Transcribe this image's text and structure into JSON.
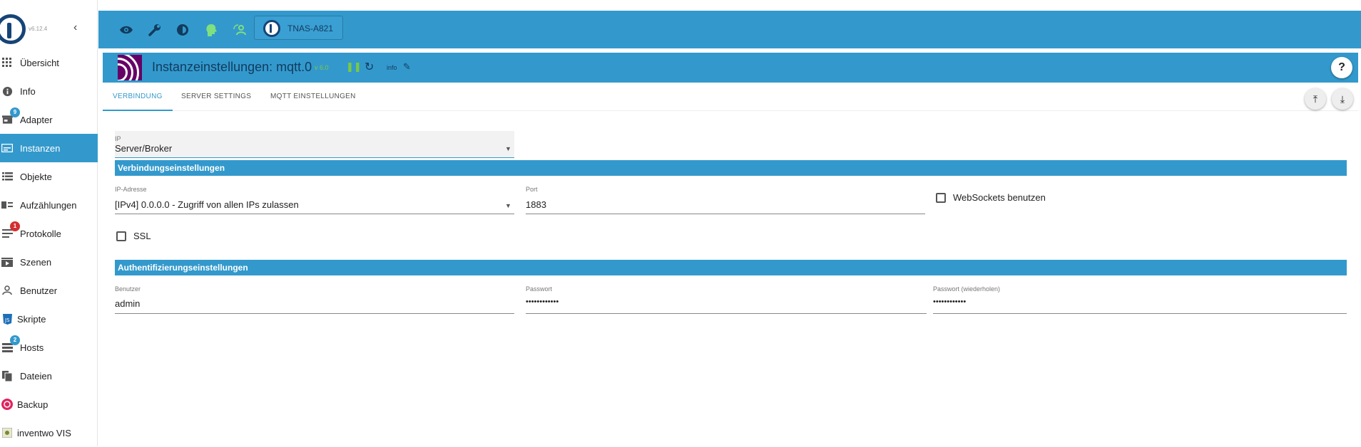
{
  "sidebar": {
    "version": "v6.12.4",
    "items": [
      {
        "label": "Übersicht",
        "icon": "grid-icon"
      },
      {
        "label": "Info",
        "icon": "info-icon"
      },
      {
        "label": "Adapter",
        "icon": "store-icon",
        "badge": "9"
      },
      {
        "label": "Instanzen",
        "icon": "instances-icon"
      },
      {
        "label": "Objekte",
        "icon": "list-icon"
      },
      {
        "label": "Aufzählungen",
        "icon": "enums-icon"
      },
      {
        "label": "Protokolle",
        "icon": "logs-icon",
        "badge": "1"
      },
      {
        "label": "Szenen",
        "icon": "scenes-icon"
      },
      {
        "label": "Benutzer",
        "icon": "user-icon"
      },
      {
        "label": "Skripte",
        "icon": "script-icon"
      },
      {
        "label": "Hosts",
        "icon": "hosts-icon",
        "badge": "2"
      },
      {
        "label": "Dateien",
        "icon": "files-icon"
      },
      {
        "label": "Backup",
        "icon": "backup-icon"
      },
      {
        "label": "inventwo VIS",
        "icon": "vis-icon"
      }
    ]
  },
  "topbar": {
    "host": "TNAS-A821"
  },
  "panel": {
    "title": "Instanzeinstellungen: mqtt.0",
    "version": "v 6.0",
    "info_label": "info",
    "tabs": [
      "VERBINDUNG",
      "SERVER SETTINGS",
      "MQTT EINSTELLUNGEN"
    ]
  },
  "form": {
    "type_label": "IP",
    "type_value": "Server/Broker",
    "section_connection": "Verbindungseinstellungen",
    "ip_label": "IP-Adresse",
    "ip_value": "[IPv4] 0.0.0.0 - Zugriff von allen IPs zulassen",
    "port_label": "Port",
    "port_value": "1883",
    "websockets_label": "WebSockets benutzen",
    "ssl_label": "SSL",
    "section_auth": "Authentifizierungseinstellungen",
    "user_label": "Benutzer",
    "user_value": "admin",
    "pass_label": "Passwort",
    "pass_value": "••••••••••••",
    "pass2_label": "Passwort (wiederholen)",
    "pass2_value": "••••••••••••"
  },
  "colors": {
    "accent": "#3399cc",
    "dark": "#123b5e",
    "mqtt": "#660066"
  }
}
